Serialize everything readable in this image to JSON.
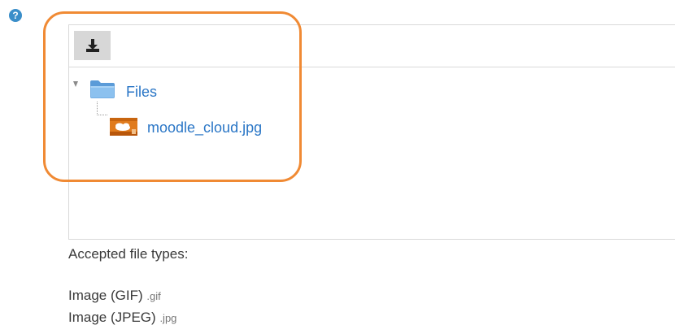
{
  "help": {
    "icon_glyph": "?",
    "icon_color": "#3a8ec9"
  },
  "file_manager": {
    "toolbar": {
      "download_icon": "download-icon"
    },
    "tree": {
      "folder": {
        "label": "Files",
        "icon": "folder-icon",
        "expanded": true
      },
      "files": [
        {
          "label": "moodle_cloud.jpg",
          "icon": "image-file-icon"
        }
      ]
    },
    "link_color": "#2a76c6",
    "highlight_color": "#f08a34"
  },
  "accepted": {
    "label": "Accepted file types:",
    "types": [
      {
        "name": "Image (GIF)",
        "ext": ".gif"
      },
      {
        "name": "Image (JPEG)",
        "ext": ".jpg"
      }
    ]
  }
}
